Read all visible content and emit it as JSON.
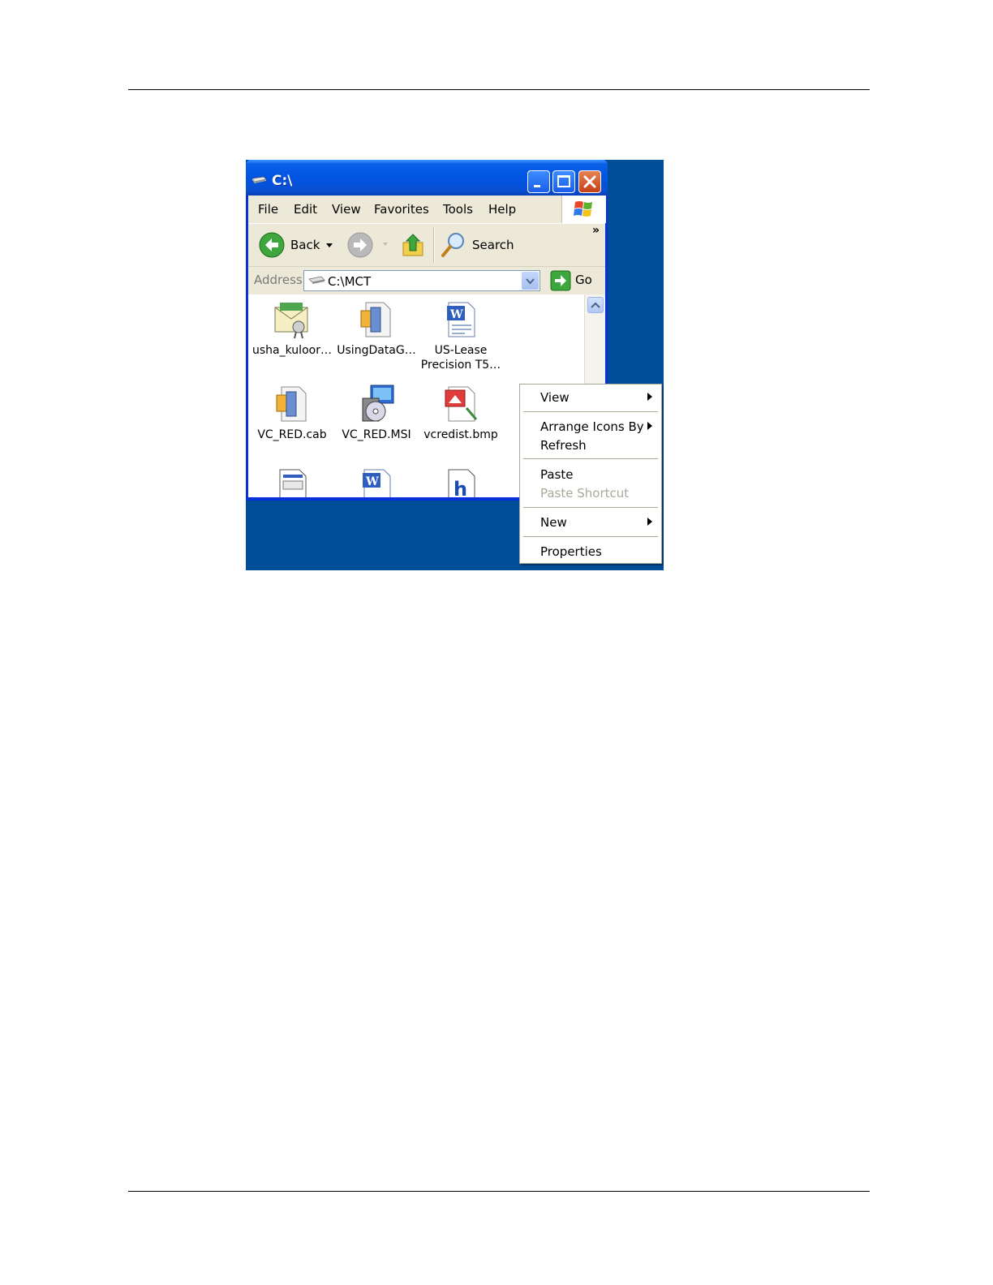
{
  "window": {
    "title": "C:\\",
    "menu": [
      "File",
      "Edit",
      "View",
      "Favorites",
      "Tools",
      "Help"
    ],
    "toolbar": {
      "back_label": "Back",
      "search_label": "Search",
      "more_chevron": "»"
    },
    "address": {
      "label": "Address",
      "value": "C:\\MCT",
      "go_label": "Go"
    }
  },
  "files": [
    {
      "name": "usha_kuloor…",
      "icon": "certificate-icon"
    },
    {
      "name": "UsingDataG…",
      "icon": "cab-file-icon"
    },
    {
      "name": "US-Lease Precision T5…",
      "icon": "word-document-icon"
    },
    {
      "name": "VC_RED.cab",
      "icon": "cab-file-icon"
    },
    {
      "name": "VC_RED.MSI",
      "icon": "installer-package-icon"
    },
    {
      "name": "vcredist.bmp",
      "icon": "bitmap-image-icon"
    },
    {
      "name": "",
      "icon": "dialog-window-icon"
    },
    {
      "name": "",
      "icon": "word-document-icon"
    },
    {
      "name": "",
      "icon": "help-file-icon"
    }
  ],
  "context_menu": {
    "items": [
      {
        "label": "View",
        "submenu": true,
        "enabled": true
      },
      {
        "label": "Arrange Icons By",
        "submenu": true,
        "enabled": true
      },
      {
        "label": "Refresh",
        "submenu": false,
        "enabled": true
      },
      {
        "label": "Paste",
        "submenu": false,
        "enabled": true
      },
      {
        "label": "Paste Shortcut",
        "submenu": false,
        "enabled": false
      },
      {
        "label": "New",
        "submenu": true,
        "enabled": true
      },
      {
        "label": "Properties",
        "submenu": false,
        "enabled": true
      }
    ]
  },
  "colors": {
    "desktop": "#004e98",
    "titlebar": "#0054e3",
    "chrome": "#ece9d8",
    "disabled_text": "#aca899"
  }
}
